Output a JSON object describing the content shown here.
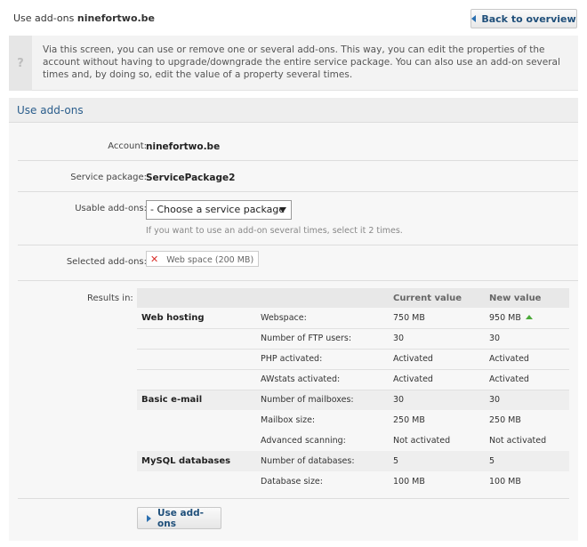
{
  "header": {
    "title_prefix": "Use add-ons",
    "title_domain": "ninefortwo.be",
    "back_label": "Back to overview"
  },
  "info": {
    "icon": "question-icon",
    "text": "Via this screen, you can use or remove one or several add-ons. This way, you can edit the properties of the account without having to upgrade/downgrade the entire service package. You can also use an add-on several times and, by doing so, edit the value of a property several times."
  },
  "panel": {
    "title": "Use add-ons",
    "account_label": "Account:",
    "account_value": "ninefortwo.be",
    "package_label": "Service package:",
    "package_value": "ServicePackage2",
    "usable_label": "Usable add-ons:",
    "select_value": "- Choose a service package",
    "hint": "If you want to use an add-on several times, select it 2 times.",
    "selected_label": "Selected add-ons:",
    "selected_addon": "Web space (200 MB)",
    "results_label": "Results in:",
    "use_button": "Use add-ons"
  },
  "results": {
    "headers": [
      "",
      "",
      "Current value",
      "New value"
    ],
    "rows": [
      {
        "group": "Web hosting",
        "property": "Webspace:",
        "current": "750 MB",
        "new": "950 MB",
        "increase": true
      },
      {
        "group": "",
        "property": "Number of FTP users:",
        "current": "30",
        "new": "30"
      },
      {
        "group": "",
        "property": "PHP activated:",
        "current": "Activated",
        "new": "Activated"
      },
      {
        "group": "",
        "property": "AWstats activated:",
        "current": "Activated",
        "new": "Activated"
      },
      {
        "group": "Basic e-mail",
        "property": "Number of mailboxes:",
        "current": "30",
        "new": "30"
      },
      {
        "group": "",
        "property": "Mailbox size:",
        "current": "250 MB",
        "new": "250 MB"
      },
      {
        "group": "",
        "property": "Advanced scanning:",
        "current": "Not activated",
        "new": "Not activated"
      },
      {
        "group": "MySQL databases",
        "property": "Number of databases:",
        "current": "5",
        "new": "5"
      },
      {
        "group": "",
        "property": "Database size:",
        "current": "100 MB",
        "new": "100 MB"
      }
    ]
  },
  "colors": {
    "accent": "#2a5d8c",
    "increase": "#4caa3a",
    "remove": "#d9302c"
  }
}
